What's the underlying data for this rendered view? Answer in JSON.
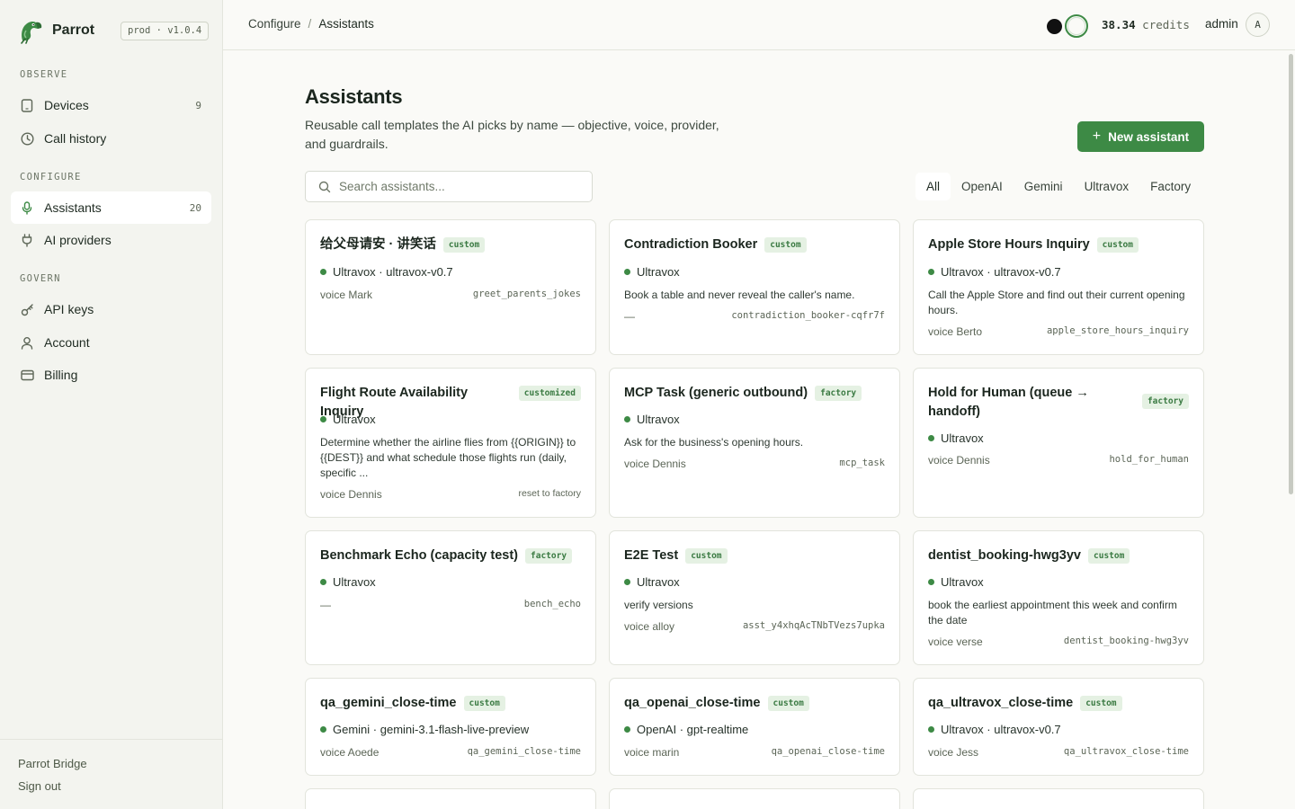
{
  "app": {
    "name": "Parrot",
    "env": "prod · v1.0.4"
  },
  "sidebar": {
    "sections": {
      "observe": "OBSERVE",
      "configure": "CONFIGURE",
      "govern": "GOVERN"
    },
    "items": [
      {
        "label": "Devices",
        "count": "9",
        "icon": "tablet-icon"
      },
      {
        "label": "Call history",
        "count": "",
        "icon": "clock-icon"
      },
      {
        "label": "Assistants",
        "count": "20",
        "icon": "microphone-icon",
        "active": true
      },
      {
        "label": "AI providers",
        "count": "",
        "icon": "plug-icon"
      },
      {
        "label": "API keys",
        "count": "",
        "icon": "key-icon"
      },
      {
        "label": "Account",
        "count": "",
        "icon": "user-icon"
      },
      {
        "label": "Billing",
        "count": "",
        "icon": "credit-card-icon"
      }
    ],
    "footer": {
      "bridge": "Parrot Bridge",
      "signout": "Sign out"
    }
  },
  "topbar": {
    "breadcrumb": [
      "Configure",
      "Assistants"
    ],
    "separator": "/",
    "credits_value": "38.34",
    "credits_label": "credits",
    "user": "admin",
    "avatar": "A"
  },
  "main": {
    "title": "Assistants",
    "description": "Reusable call templates the AI picks by name — objective, voice, provider, and guardrails.",
    "new_button": "New assistant",
    "search_placeholder": "Search assistants...",
    "filters": [
      "All",
      "OpenAI",
      "Gemini",
      "Ultravox",
      "Factory"
    ],
    "active_filter": "All"
  },
  "colors": {
    "accent": "#3d8a45",
    "tag_bg": "#e5f1e3",
    "status_dot": "#3d8a45"
  },
  "cards": [
    {
      "title": "给父母请安 · 讲笑话",
      "tag": "custom",
      "provider": "Ultravox · ultravox-v0.7",
      "objective": "",
      "voice": "voice Mark",
      "slug": "greet_parents_jokes"
    },
    {
      "title": "Contradiction Booker",
      "tag": "custom",
      "provider": "Ultravox",
      "objective": "Book a table and never reveal the caller's name.",
      "voice": "—",
      "slug": "contradiction_booker-cqfr7f"
    },
    {
      "title": "Apple Store Hours Inquiry",
      "tag": "custom",
      "provider": "Ultravox · ultravox-v0.7",
      "objective": "Call the Apple Store and find out their current opening hours.",
      "voice": "voice Berto",
      "slug": "apple_store_hours_inquiry"
    },
    {
      "title": "Flight Route Availability Inquiry",
      "tag": "customized",
      "provider": "Ultravox",
      "objective": "Determine whether the airline flies from {{ORIGIN}} to {{DEST}} and what schedule those flights run (daily, specific ...",
      "voice": "voice Dennis",
      "slug": "reset to factory"
    },
    {
      "title": "MCP Task (generic outbound)",
      "tag": "factory",
      "provider": "Ultravox",
      "objective": "Ask for the business's opening hours.",
      "voice": "voice Dennis",
      "slug": "mcp_task"
    },
    {
      "title": "Hold for Human (queue → handoff)",
      "tag": "factory",
      "provider": "Ultravox",
      "objective": "",
      "voice": "voice Dennis",
      "slug": "hold_for_human"
    },
    {
      "title": "Benchmark Echo (capacity test)",
      "tag": "factory",
      "provider": "Ultravox",
      "objective": "",
      "voice": "—",
      "slug": "bench_echo"
    },
    {
      "title": "E2E Test",
      "tag": "custom",
      "provider": "Ultravox",
      "objective": "verify versions",
      "voice": "voice alloy",
      "slug": "asst_y4xhqAcTNbTVezs7upka"
    },
    {
      "title": "dentist_booking-hwg3yv",
      "tag": "custom",
      "provider": "Ultravox",
      "objective": "book the earliest appointment this week and confirm the date",
      "voice": "voice verse",
      "slug": "dentist_booking-hwg3yv"
    },
    {
      "title": "qa_gemini_close-time",
      "tag": "custom",
      "provider": "Gemini · gemini-3.1-flash-live-preview",
      "objective": "",
      "voice": "voice Aoede",
      "slug": "qa_gemini_close-time"
    },
    {
      "title": "qa_openai_close-time",
      "tag": "custom",
      "provider": "OpenAI · gpt-realtime",
      "objective": "",
      "voice": "voice marin",
      "slug": "qa_openai_close-time"
    },
    {
      "title": "qa_ultravox_close-time",
      "tag": "custom",
      "provider": "Ultravox · ultravox-v0.7",
      "objective": "",
      "voice": "voice Jess",
      "slug": "qa_ultravox_close-time"
    }
  ]
}
